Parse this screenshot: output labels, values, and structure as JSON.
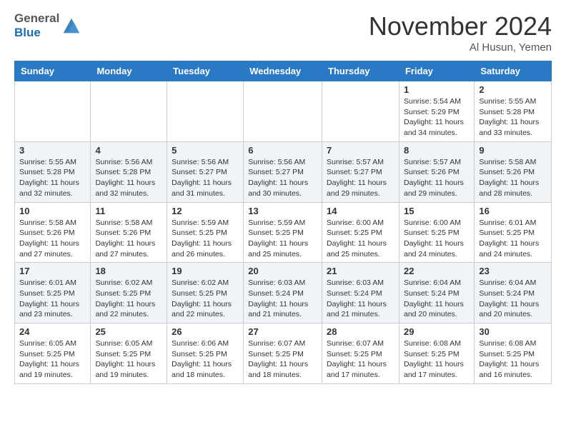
{
  "header": {
    "logo_line1": "General",
    "logo_line2": "Blue",
    "month": "November 2024",
    "location": "Al Husun, Yemen"
  },
  "weekdays": [
    "Sunday",
    "Monday",
    "Tuesday",
    "Wednesday",
    "Thursday",
    "Friday",
    "Saturday"
  ],
  "weeks": [
    [
      {
        "day": "",
        "info": ""
      },
      {
        "day": "",
        "info": ""
      },
      {
        "day": "",
        "info": ""
      },
      {
        "day": "",
        "info": ""
      },
      {
        "day": "",
        "info": ""
      },
      {
        "day": "1",
        "info": "Sunrise: 5:54 AM\nSunset: 5:29 PM\nDaylight: 11 hours and 34 minutes."
      },
      {
        "day": "2",
        "info": "Sunrise: 5:55 AM\nSunset: 5:28 PM\nDaylight: 11 hours and 33 minutes."
      }
    ],
    [
      {
        "day": "3",
        "info": "Sunrise: 5:55 AM\nSunset: 5:28 PM\nDaylight: 11 hours and 32 minutes."
      },
      {
        "day": "4",
        "info": "Sunrise: 5:56 AM\nSunset: 5:28 PM\nDaylight: 11 hours and 32 minutes."
      },
      {
        "day": "5",
        "info": "Sunrise: 5:56 AM\nSunset: 5:27 PM\nDaylight: 11 hours and 31 minutes."
      },
      {
        "day": "6",
        "info": "Sunrise: 5:56 AM\nSunset: 5:27 PM\nDaylight: 11 hours and 30 minutes."
      },
      {
        "day": "7",
        "info": "Sunrise: 5:57 AM\nSunset: 5:27 PM\nDaylight: 11 hours and 29 minutes."
      },
      {
        "day": "8",
        "info": "Sunrise: 5:57 AM\nSunset: 5:26 PM\nDaylight: 11 hours and 29 minutes."
      },
      {
        "day": "9",
        "info": "Sunrise: 5:58 AM\nSunset: 5:26 PM\nDaylight: 11 hours and 28 minutes."
      }
    ],
    [
      {
        "day": "10",
        "info": "Sunrise: 5:58 AM\nSunset: 5:26 PM\nDaylight: 11 hours and 27 minutes."
      },
      {
        "day": "11",
        "info": "Sunrise: 5:58 AM\nSunset: 5:26 PM\nDaylight: 11 hours and 27 minutes."
      },
      {
        "day": "12",
        "info": "Sunrise: 5:59 AM\nSunset: 5:25 PM\nDaylight: 11 hours and 26 minutes."
      },
      {
        "day": "13",
        "info": "Sunrise: 5:59 AM\nSunset: 5:25 PM\nDaylight: 11 hours and 25 minutes."
      },
      {
        "day": "14",
        "info": "Sunrise: 6:00 AM\nSunset: 5:25 PM\nDaylight: 11 hours and 25 minutes."
      },
      {
        "day": "15",
        "info": "Sunrise: 6:00 AM\nSunset: 5:25 PM\nDaylight: 11 hours and 24 minutes."
      },
      {
        "day": "16",
        "info": "Sunrise: 6:01 AM\nSunset: 5:25 PM\nDaylight: 11 hours and 24 minutes."
      }
    ],
    [
      {
        "day": "17",
        "info": "Sunrise: 6:01 AM\nSunset: 5:25 PM\nDaylight: 11 hours and 23 minutes."
      },
      {
        "day": "18",
        "info": "Sunrise: 6:02 AM\nSunset: 5:25 PM\nDaylight: 11 hours and 22 minutes."
      },
      {
        "day": "19",
        "info": "Sunrise: 6:02 AM\nSunset: 5:25 PM\nDaylight: 11 hours and 22 minutes."
      },
      {
        "day": "20",
        "info": "Sunrise: 6:03 AM\nSunset: 5:24 PM\nDaylight: 11 hours and 21 minutes."
      },
      {
        "day": "21",
        "info": "Sunrise: 6:03 AM\nSunset: 5:24 PM\nDaylight: 11 hours and 21 minutes."
      },
      {
        "day": "22",
        "info": "Sunrise: 6:04 AM\nSunset: 5:24 PM\nDaylight: 11 hours and 20 minutes."
      },
      {
        "day": "23",
        "info": "Sunrise: 6:04 AM\nSunset: 5:24 PM\nDaylight: 11 hours and 20 minutes."
      }
    ],
    [
      {
        "day": "24",
        "info": "Sunrise: 6:05 AM\nSunset: 5:25 PM\nDaylight: 11 hours and 19 minutes."
      },
      {
        "day": "25",
        "info": "Sunrise: 6:05 AM\nSunset: 5:25 PM\nDaylight: 11 hours and 19 minutes."
      },
      {
        "day": "26",
        "info": "Sunrise: 6:06 AM\nSunset: 5:25 PM\nDaylight: 11 hours and 18 minutes."
      },
      {
        "day": "27",
        "info": "Sunrise: 6:07 AM\nSunset: 5:25 PM\nDaylight: 11 hours and 18 minutes."
      },
      {
        "day": "28",
        "info": "Sunrise: 6:07 AM\nSunset: 5:25 PM\nDaylight: 11 hours and 17 minutes."
      },
      {
        "day": "29",
        "info": "Sunrise: 6:08 AM\nSunset: 5:25 PM\nDaylight: 11 hours and 17 minutes."
      },
      {
        "day": "30",
        "info": "Sunrise: 6:08 AM\nSunset: 5:25 PM\nDaylight: 11 hours and 16 minutes."
      }
    ]
  ]
}
